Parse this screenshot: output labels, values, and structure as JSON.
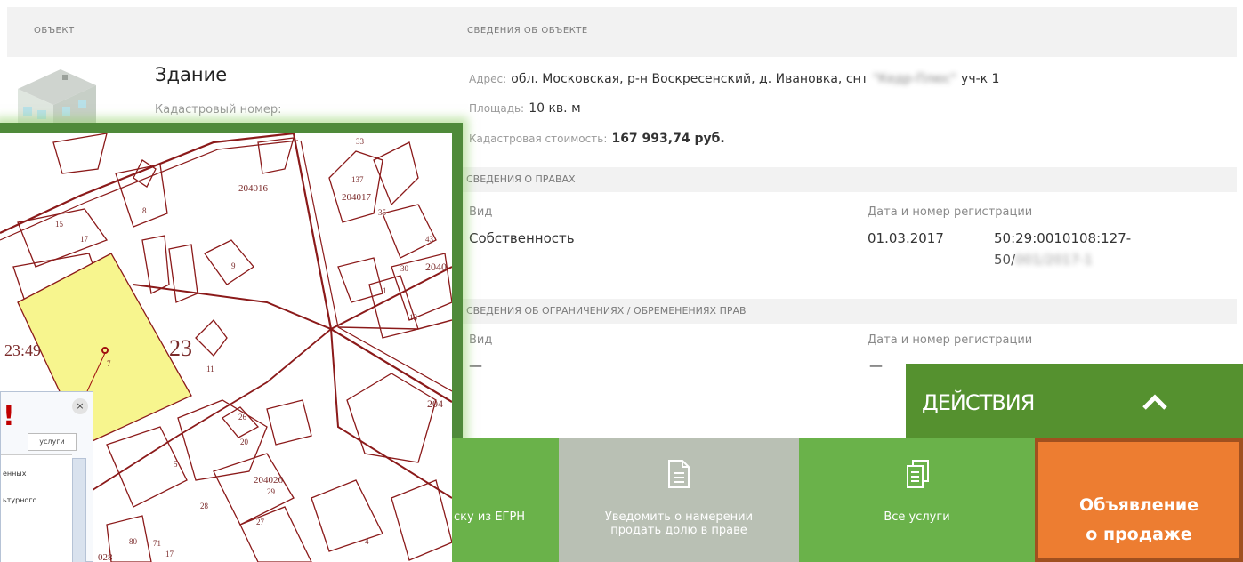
{
  "header": {
    "object_col": "ОБЪЕКТ",
    "info_col": "СВЕДЕНИЯ ОБ ОБЪЕКТЕ"
  },
  "object": {
    "type": "Здание",
    "cadastral_label": "Кадастровый номер:"
  },
  "info": {
    "address_label": "Адрес:",
    "address_value": "обл. Московская, р-н Воскресенский, д. Ивановка, снт",
    "address_tail": "уч-к 1",
    "area_label": "Площадь:",
    "area_value": "10 кв. м",
    "cost_label": "Кадастровая стоимость:",
    "cost_value": "167 993,74 руб."
  },
  "rights": {
    "section": "СВЕДЕНИЯ О ПРАВАХ",
    "kind_label": "Вид",
    "kind_value": "Собственность",
    "reg_label": "Дата и номер регистрации",
    "reg_date": "01.03.2017",
    "reg_number_1": "50:29:0010108:127-",
    "reg_number_2": "50/"
  },
  "restrictions": {
    "section": "СВЕДЕНИЯ ОБ ОГРАНИЧЕНИЯХ / ОБРЕМЕНЕНИЯХ ПРАВ",
    "kind_label": "Вид",
    "kind_value": "—",
    "reg_label": "Дата и номер регистрации",
    "reg_value": "—"
  },
  "map": {
    "labels": [
      "204016",
      "204017",
      "137",
      "204026",
      "23",
      "23:49",
      "204",
      "2040",
      "8",
      "9",
      "15",
      "17",
      "13",
      "7",
      "5",
      "26",
      "20",
      "28",
      "27",
      "29",
      "4",
      "80",
      "71",
      "17",
      "028",
      "33",
      "35",
      "43",
      "30",
      "1",
      "11"
    ],
    "popup": {
      "alert": "!",
      "close": "×",
      "tab": "услуги",
      "items": [
        "енных",
        "ьтурного"
      ]
    }
  },
  "actions": {
    "title": "ДЕЙСТВИЯ",
    "buttons": {
      "egrn": "ску из ЕГРН",
      "notify": "Уведомить о намерении продать долю в праве",
      "all": "Все услуги",
      "sale_1": "Объявление",
      "sale_2": "о продаже"
    }
  },
  "colors": {
    "green_dark": "#55912f",
    "green": "#6ab24a",
    "gray_button": "#b9c0b4",
    "orange": "#ed7d31",
    "parcel_fill": "#f7f58e",
    "map_line": "#8b1a1a"
  }
}
